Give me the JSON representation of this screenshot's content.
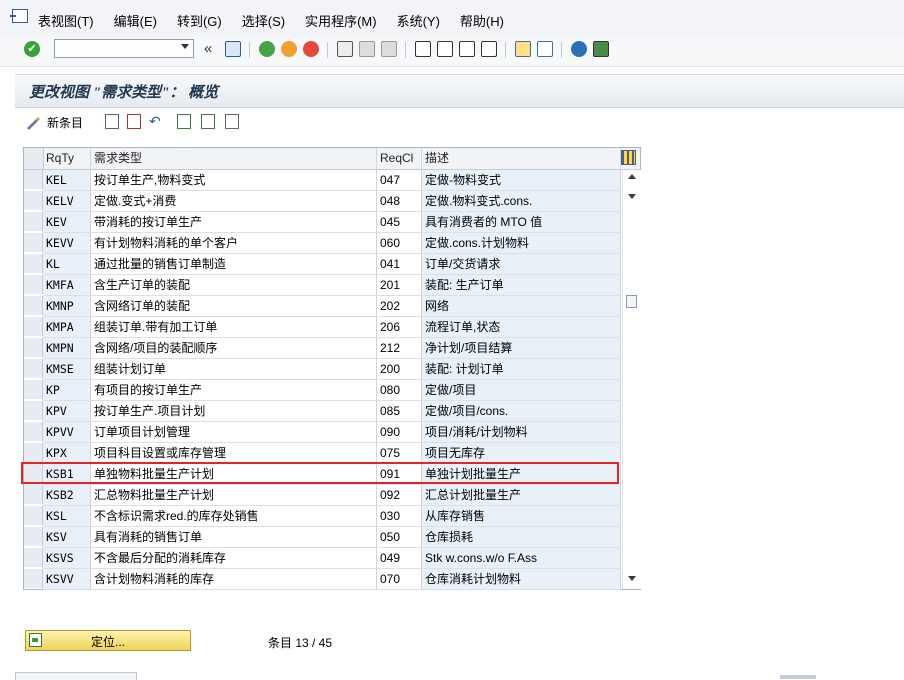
{
  "menubar": {
    "items": [
      "表视图(T)",
      "编辑(E)",
      "转到(G)",
      "选择(S)",
      "实用程序(M)",
      "系统(Y)",
      "帮助(H)"
    ]
  },
  "toolbar": {
    "command_field_value": "",
    "back_symbol": "«"
  },
  "page": {
    "title": "更改视图 \"需求类型\"： 概览"
  },
  "app_toolbar": {
    "new_entries_label": "新条目"
  },
  "table": {
    "headers": {
      "code": "RqTy",
      "name": "需求类型",
      "class": "ReqCl",
      "desc": "描述"
    },
    "rows": [
      {
        "code": "KEL",
        "name": "按订单生产,物料变式",
        "cls": "047",
        "desc": "定做-物料变式"
      },
      {
        "code": "KELV",
        "name": "定做.变式+消费",
        "cls": "048",
        "desc": "定做.物料变式.cons."
      },
      {
        "code": "KEV",
        "name": "带消耗的按订单生产",
        "cls": "045",
        "desc": "具有消费者的 MTO 值"
      },
      {
        "code": "KEVV",
        "name": "有计划物料消耗的单个客户",
        "cls": "060",
        "desc": "定做.cons.计划物料"
      },
      {
        "code": "KL",
        "name": "通过批量的销售订单制造",
        "cls": "041",
        "desc": "订单/交货请求"
      },
      {
        "code": "KMFA",
        "name": "含生产订单的装配",
        "cls": "201",
        "desc": "装配: 生产订单"
      },
      {
        "code": "KMNP",
        "name": "含网络订单的装配",
        "cls": "202",
        "desc": "网络"
      },
      {
        "code": "KMPA",
        "name": "组装订单.带有加工订单",
        "cls": "206",
        "desc": "流程订单,状态"
      },
      {
        "code": "KMPN",
        "name": "含网络/项目的装配顺序",
        "cls": "212",
        "desc": "净计划/项目结算"
      },
      {
        "code": "KMSE",
        "name": "组装计划订单",
        "cls": "200",
        "desc": "装配: 计划订单"
      },
      {
        "code": "KP",
        "name": "有项目的按订单生产",
        "cls": "080",
        "desc": "定做/项目"
      },
      {
        "code": "KPV",
        "name": "按订单生产.项目计划",
        "cls": "085",
        "desc": "定做/项目/cons."
      },
      {
        "code": "KPVV",
        "name": "订单项目计划管理",
        "cls": "090",
        "desc": "项目/消耗/计划物料"
      },
      {
        "code": "KPX",
        "name": "项目科目设置或库存管理",
        "cls": "075",
        "desc": "项目无库存"
      },
      {
        "code": "KSB1",
        "name": "单独物料批量生产计划",
        "cls": "091",
        "desc": "单独计划批量生产"
      },
      {
        "code": "KSB2",
        "name": "汇总物料批量生产计划",
        "cls": "092",
        "desc": "汇总计划批量生产"
      },
      {
        "code": "KSL",
        "name": "不含标识需求red.的库存处销售",
        "cls": "030",
        "desc": "从库存销售"
      },
      {
        "code": "KSV",
        "name": "具有消耗的销售订单",
        "cls": "050",
        "desc": "仓库损耗"
      },
      {
        "code": "KSVS",
        "name": "不含最后分配的消耗库存",
        "cls": "049",
        "desc": "Stk w.cons.w/o F.Ass"
      },
      {
        "code": "KSVV",
        "name": "含计划物料消耗的库存",
        "cls": "070",
        "desc": "仓库消耗计划物料"
      }
    ],
    "highlighted_code": "KSB1"
  },
  "footer": {
    "position_button_label": "定位...",
    "entry_count": "条目 13 / 45"
  },
  "colors": {
    "highlight_border": "#e0262a",
    "title_text": "#23374f",
    "position_button": "#f0d35a"
  },
  "icons": [
    "enter-icon",
    "save-icon",
    "back-icon",
    "exit-icon",
    "cancel-icon",
    "print-icon",
    "find-icon",
    "find-next-icon",
    "first-page-icon",
    "previous-page-icon",
    "next-page-icon",
    "last-page-icon",
    "create-session-icon",
    "shortcut-icon",
    "help-icon",
    "customize-layout-icon"
  ]
}
